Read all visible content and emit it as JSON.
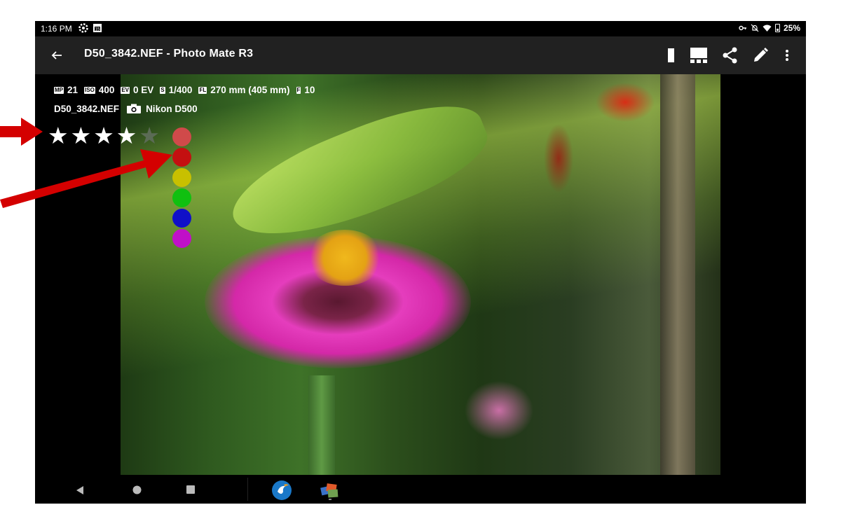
{
  "status_bar": {
    "time": "1:16 PM",
    "icons_left": [
      "settings-gear-icon",
      "calendar-icon"
    ],
    "icons_right": [
      "vpn-key-icon",
      "notifications-off-icon",
      "wifi-icon",
      "battery-icon"
    ],
    "battery": "25%"
  },
  "app_bar": {
    "title": "D50_3842.NEF - Photo Mate R3",
    "back_icon": "arrow-back-icon",
    "actions": [
      "single-view-icon",
      "filmstrip-view-icon",
      "share-icon",
      "edit-pencil-icon",
      "more-vert-icon"
    ]
  },
  "exif": {
    "megapixels_tag": "MP",
    "megapixels": "21",
    "iso_tag": "ISO",
    "iso": "400",
    "ev_tag": "EV",
    "ev": "0 EV",
    "shutter_tag": "S",
    "shutter": "1/400",
    "focal_tag": "FL",
    "focal": "270 mm (405 mm)",
    "fnumber_tag": "F",
    "fnumber": "10",
    "filename": "D50_3842.NEF",
    "camera": "Nikon D500"
  },
  "rating": {
    "value": 4,
    "max": 5
  },
  "color_labels": [
    "#d04a4a",
    "#c41010",
    "#c8c000",
    "#10c010",
    "#1010c8",
    "#c010c8"
  ],
  "nav_bar": {
    "buttons": [
      "back-triangle-icon",
      "home-circle-icon",
      "recents-square-icon"
    ],
    "apps": [
      "bird-app-icon",
      "photo-mate-app-icon"
    ]
  },
  "annotation_color": "#d40000"
}
